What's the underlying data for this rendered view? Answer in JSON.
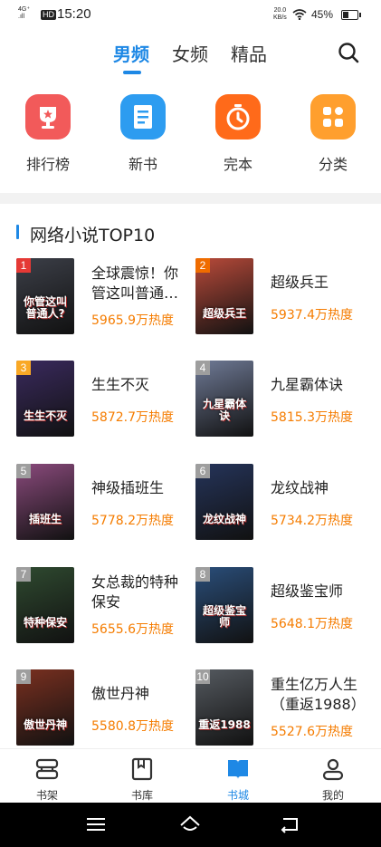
{
  "status_bar": {
    "network": "4G⁺ᴴᴰ",
    "hd": "HD",
    "time": "15:20",
    "speed_value": "20.0",
    "speed_unit": "KB/s",
    "battery": "45%"
  },
  "tabs": [
    {
      "label": "男频",
      "active": true
    },
    {
      "label": "女频",
      "active": false
    },
    {
      "label": "精品",
      "active": false
    }
  ],
  "quick_links": [
    {
      "label": "排行榜",
      "icon": "trophy-icon",
      "color": "#f25a5a"
    },
    {
      "label": "新书",
      "icon": "book-icon",
      "color": "#2d9cf0"
    },
    {
      "label": "完本",
      "icon": "timer-icon",
      "color": "#ff6a1a"
    },
    {
      "label": "分类",
      "icon": "grid-icon",
      "color": "#ff9f2e"
    }
  ],
  "section_title": "网络小说TOP10",
  "ranking": [
    {
      "rank": "1",
      "title": "全球震惊！你管这叫普通人？",
      "heat": "5965.9万热度",
      "cover_text": "你管这叫普通人?",
      "cover_color": "#3c3f48",
      "badge_color": "#e53935"
    },
    {
      "rank": "2",
      "title": "超级兵王",
      "heat": "5937.4万热度",
      "cover_text": "超级兵王",
      "cover_color": "#b84a3a",
      "badge_color": "#ef6c00"
    },
    {
      "rank": "3",
      "title": "生生不灭",
      "heat": "5872.7万热度",
      "cover_text": "生生不灭",
      "cover_color": "#3a2a5e",
      "badge_color": "#f9a825"
    },
    {
      "rank": "4",
      "title": "九星霸体诀",
      "heat": "5815.3万热度",
      "cover_text": "九星霸体诀",
      "cover_color": "#6f7a96",
      "badge_color": "#9e9e9e"
    },
    {
      "rank": "5",
      "title": "神级插班生",
      "heat": "5778.2万热度",
      "cover_text": "插班生",
      "cover_color": "#8a4a7c",
      "badge_color": "#9e9e9e"
    },
    {
      "rank": "6",
      "title": "龙纹战神",
      "heat": "5734.2万热度",
      "cover_text": "龙纹战神",
      "cover_color": "#25345a",
      "badge_color": "#9e9e9e"
    },
    {
      "rank": "7",
      "title": "女总裁的特种保安",
      "heat": "5655.6万热度",
      "cover_text": "特种保安",
      "cover_color": "#2f4a30",
      "badge_color": "#9e9e9e"
    },
    {
      "rank": "8",
      "title": "超级鉴宝师",
      "heat": "5648.1万热度",
      "cover_text": "超级鉴宝师",
      "cover_color": "#2a4e7a",
      "badge_color": "#9e9e9e"
    },
    {
      "rank": "9",
      "title": "傲世丹神",
      "heat": "5580.8万热度",
      "cover_text": "傲世丹神",
      "cover_color": "#7a3020",
      "badge_color": "#9e9e9e"
    },
    {
      "rank": "10",
      "title": "重生亿万人生（重返1988）",
      "heat": "5527.6万热度",
      "cover_text": "重返1988",
      "cover_color": "#555a60",
      "badge_color": "#9e9e9e"
    }
  ],
  "bottom_nav": [
    {
      "label": "书架",
      "icon": "bookshelf-icon",
      "active": false
    },
    {
      "label": "书库",
      "icon": "library-icon",
      "active": false
    },
    {
      "label": "书城",
      "icon": "bookstore-icon",
      "active": true
    },
    {
      "label": "我的",
      "icon": "profile-icon",
      "active": false
    }
  ],
  "colors": {
    "accent": "#1e88e5",
    "heat": "#f57c00"
  }
}
